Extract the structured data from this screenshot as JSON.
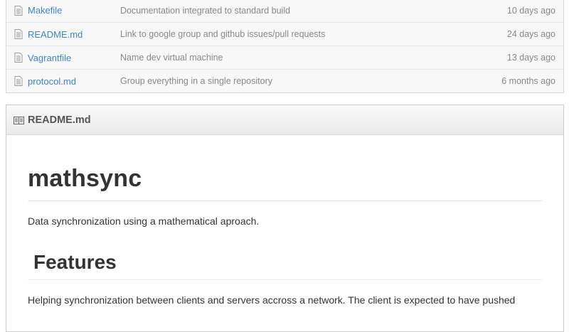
{
  "files": [
    {
      "name": "Makefile",
      "message": "Documentation integrated to standard build",
      "age": "10 days ago",
      "icon": "file-icon"
    },
    {
      "name": "README.md",
      "message": "Link to google group and github issues/pull requests",
      "age": "24 days ago",
      "icon": "file-icon"
    },
    {
      "name": "Vagrantfile",
      "message": "Name dev virtual machine",
      "age": "13 days ago",
      "icon": "file-icon"
    },
    {
      "name": "protocol.md",
      "message": "Group everything in a single repository",
      "age": "6 months ago",
      "icon": "file-icon"
    }
  ],
  "readme": {
    "header_title": "README.md",
    "header_icon": "book-icon",
    "title": "mathsync",
    "description": "Data synchronization using a mathematical aproach.",
    "features_heading": "Features",
    "features_text": "Helping synchronization between clients and servers accross a network. The client is expected to have pushed"
  },
  "colors": {
    "link": "#4183c4",
    "muted": "#888888",
    "text": "#333333"
  }
}
